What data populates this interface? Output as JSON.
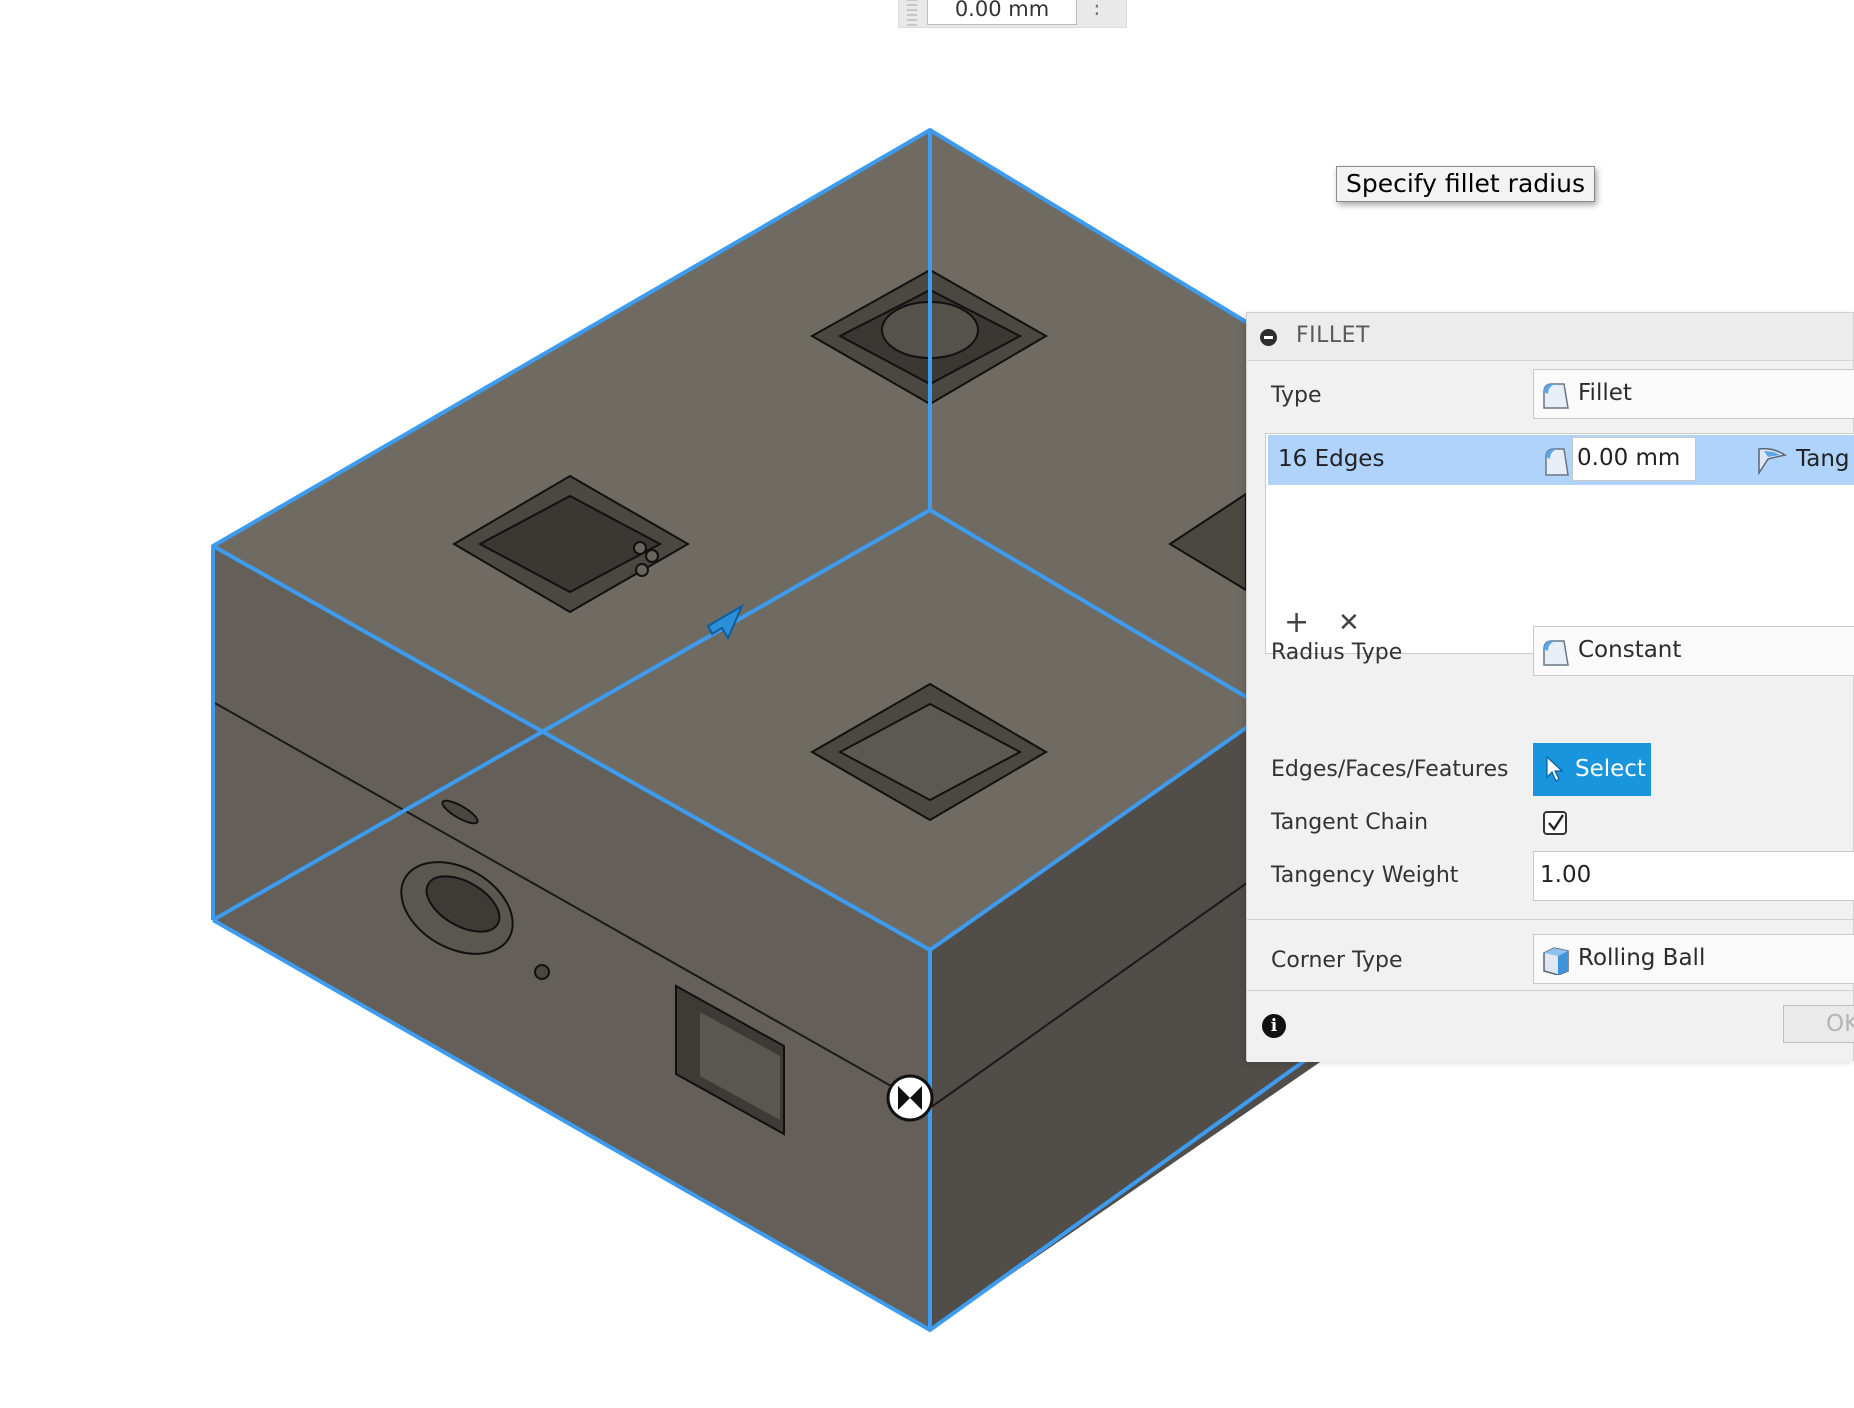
{
  "toolbar": {
    "value": "0.00 mm"
  },
  "tooltip": {
    "text": "Specify fillet radius"
  },
  "panel": {
    "title": "FILLET",
    "type": {
      "label": "Type",
      "value": "Fillet"
    },
    "edges": {
      "count_label": "16 Edges",
      "radius_value": "0.00 mm",
      "continuity": "Tang"
    },
    "radius_type": {
      "label": "Radius Type",
      "value": "Constant"
    },
    "edges_faces_features": {
      "label": "Edges/Faces/Features",
      "button": "Select"
    },
    "tangent_chain": {
      "label": "Tangent Chain",
      "checked": true
    },
    "tangency_weight": {
      "label": "Tangency Weight",
      "value": "1.00"
    },
    "corner_type": {
      "label": "Corner Type",
      "value": "Rolling Ball"
    },
    "ok_label": "OK"
  },
  "colors": {
    "selection_edge": "#3d9bf0",
    "select_button": "#1895dd",
    "list_highlight": "#afd3fb",
    "face_top": "#706b62",
    "face_left": "#645f58",
    "face_right": "#514d48"
  }
}
